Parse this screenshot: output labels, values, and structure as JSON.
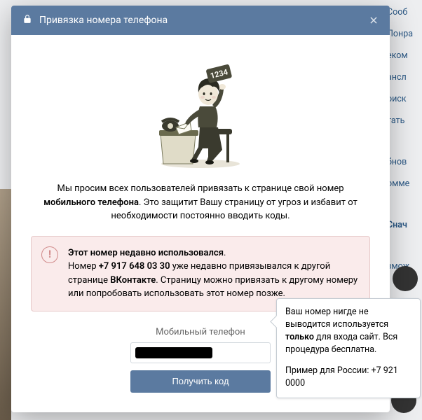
{
  "header": {
    "title": "Привязка номера телефона"
  },
  "intro": {
    "pre": "Мы просим всех пользователей привязать к странице свой номер ",
    "bold": "мобильного телефона",
    "post": ". Это защитит Вашу страницу от угроз и избавит от необходимости постоянно вводить коды."
  },
  "warning": {
    "line1_bold": "Этот номер недавно использовался",
    "line1_post": ".",
    "line2_pre": "Номер ",
    "phone": "+7 917 648 03 30",
    "line2_mid": " уже недавно привязывался к другой странице ",
    "brand": "ВКонтакте",
    "line2_post": ". Страницу можно привязать к другому номеру или попробовать использовать этот номер позже."
  },
  "form": {
    "label": "Мобильный телефон",
    "submit": "Получить код"
  },
  "tooltip": {
    "line1_pre": "Ваш номер нигде не выводится",
    "line1_mid": " используется ",
    "line1_bold": "только",
    "line1_post": " для входа",
    "line2": " сайт. Вся процедура бесплатна.",
    "example": "Пример для России: +7 921 0000"
  },
  "illustration": {
    "badge": "1234"
  },
  "bg": {
    "items": [
      "Сооб",
      "Понра",
      "еком",
      "ансл",
      "оиск",
      "тать",
      "бнов",
      "омме",
      "Снач",
      "змож"
    ]
  }
}
